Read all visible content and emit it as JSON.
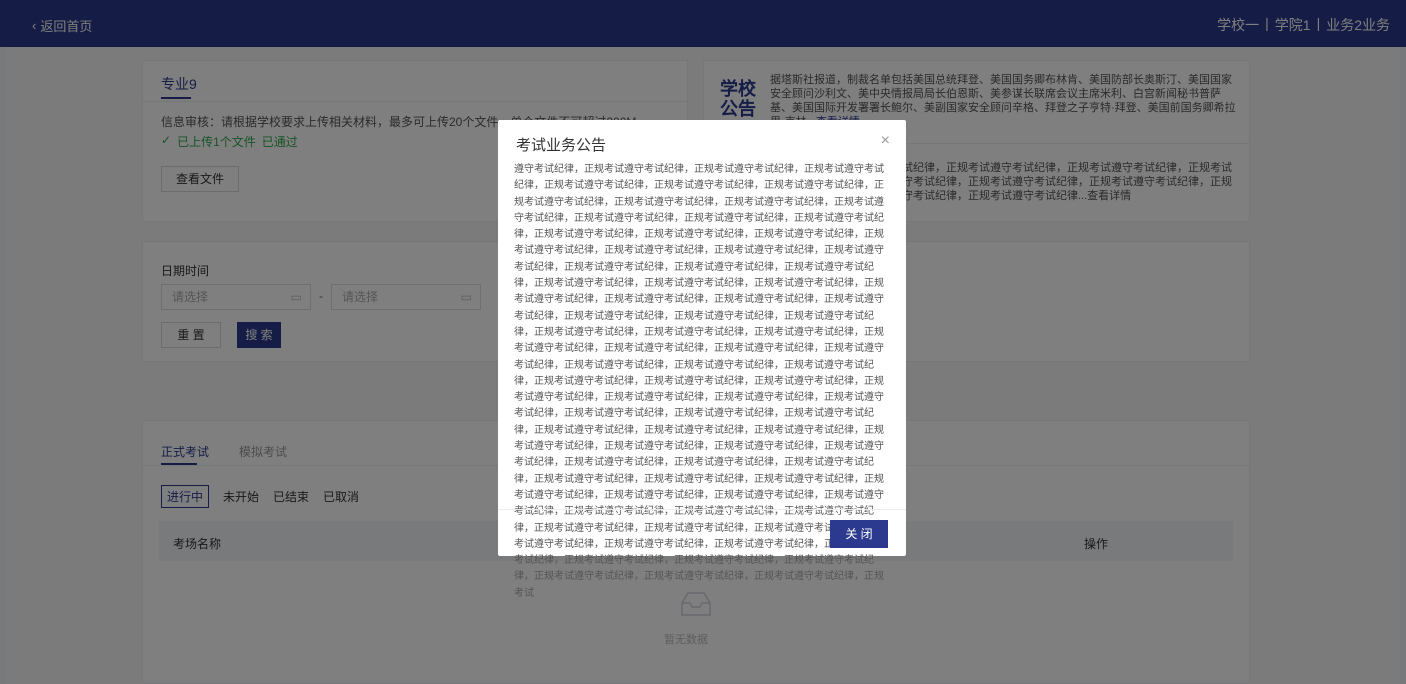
{
  "header": {
    "back_label": "返回首页",
    "school": "学校一",
    "college": "学院1",
    "business": "业务2业务"
  },
  "major_card": {
    "tab": "专业9",
    "info": "信息审核：请根据学校要求上传相关材料，最多可上传20个文件，单个文件不可超过200M",
    "uploaded": "已上传1个文件",
    "approved": "已通过",
    "view_file": "查看文件"
  },
  "notice_card": {
    "logo_line1": "学校",
    "logo_line2": "公告",
    "text1": "据塔斯社报道，制裁名单包括美国总统拜登、美国国务卿布林肯、美国防部长奥斯汀、美国国家安全顾问沙利文、美中央情报局局长伯恩斯、美参谋长联席会议主席米利、白宫新闻秘书普萨基、美国国际开发署署长鲍尔、美副国家安全顾问辛格、拜登之子亨特·拜登、美国前国务卿希拉里·克林...",
    "text1_more": "查看详情",
    "text2": "考试纪律，正规考试遵守考试纪律，正规考试遵守考试纪律，正规考试遵守考试纪律，正规考试遵守考试纪律，正规考试遵守考试纪律，正规考试遵守考试纪律，正规考试遵守考试纪律，正规考试遵守纪律，正规考试遵守考试纪律，正规考试遵守考试纪律...",
    "text2_more": "查看详情"
  },
  "search": {
    "date_label": "日期时间",
    "start_placeholder": "请选择",
    "end_placeholder": "请选择",
    "separator": "-",
    "reset": "重 置",
    "search": "搜 索"
  },
  "exams": {
    "tabs": [
      "正式考试",
      "模拟考试"
    ],
    "filters": [
      "进行中",
      "未开始",
      "已结束",
      "已取消"
    ],
    "col_name": "考场名称",
    "col_action": "操作",
    "empty": "暂无数据"
  },
  "modal": {
    "title": "考试业务公告",
    "close_icon": "×",
    "body": "遵守考试纪律，正规考试遵守考试纪律，正规考试遵守考试纪律，正规考试遵守考试纪律，正规考试遵守考试纪律，正规考试遵守考试纪律，正规考试遵守考试纪律，正规考试遵守考试纪律，正规考试遵守考试纪律，正规考试遵守考试纪律，正规考试遵守考试纪律，正规考试遵守考试纪律，正规考试遵守考试纪律，正规考试遵守考试纪律，正规考试遵守考试纪律，正规考试遵守考试纪律，正规考试遵守考试纪律，正规考试遵守考试纪律，正规考试遵守考试纪律，正规考试遵守考试纪律，正规考试遵守考试纪律，正规考试遵守考试纪律，正规考试遵守考试纪律，正规考试遵守考试纪律，正规考试遵守考试纪律，正规考试遵守考试纪律，正规考试遵守考试纪律，正规考试遵守考试纪律，正规考试遵守考试纪律，正规考试遵守考试纪律，正规考试遵守考试纪律，正规考试遵守考试纪律，正规考试遵守考试纪律，正规考试遵守考试纪律，正规考试遵守考试纪律，正规考试遵守考试纪律，正规考试遵守考试纪律，正规考试遵守考试纪律，正规考试遵守考试纪律，正规考试遵守考试纪律，正规考试遵守考试纪律，正规考试遵守考试纪律，正规考试遵守考试纪律，正规考试遵守考试纪律，正规考试遵守考试纪律，正规考试遵守考试纪律，正规考试遵守考试纪律，正规考试遵守考试纪律，正规考试遵守考试纪律，正规考试遵守考试纪律，正规考试遵守考试纪律，正规考试遵守考试纪律，正规考试遵守考试纪律，正规考试遵守考试纪律，正规考试遵守考试纪律，正规考试遵守考试纪律，正规考试遵守考试纪律，正规考试遵守考试纪律，正规考试遵守考试纪律，正规考试遵守考试纪律，正规考试遵守考试纪律，正规考试遵守考试纪律，正规考试遵守考试纪律，正规考试遵守考试纪律，正规考试遵守考试纪律，正规考试遵守考试纪律，正规考试遵守考试纪律，正规考试遵守考试纪律，正规考试遵守考试纪律，正规考试遵守考试纪律，正规考试遵守考试纪律，正规考试遵守考试纪律，正规考试遵守考试纪律，正规考试遵守考试纪律，正规考试遵守考试纪律，正规考试遵守考试纪律，正规考试遵守考试纪律，正规考试遵守考试纪律，正规考试遵守考试纪律，正规考试遵守考试纪律，正规考试遵守考试纪律，正规考试遵守考试纪律，正规考试遵守考试纪律，正规考试遵守考试纪律，正规考试遵守考试纪律，正规考试遵守考试纪律，正规考试遵守考试纪律，正规考试",
    "ok": "关 闭"
  }
}
